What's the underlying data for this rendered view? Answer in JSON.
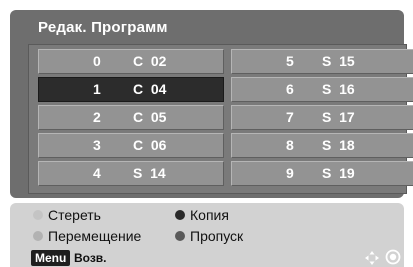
{
  "window": {
    "title": "Редак. Программ"
  },
  "channels": {
    "left": [
      {
        "num": "0",
        "channel": "C  02",
        "selected": false
      },
      {
        "num": "1",
        "channel": "C  04",
        "selected": true
      },
      {
        "num": "2",
        "channel": "C  05",
        "selected": false
      },
      {
        "num": "3",
        "channel": "C  06",
        "selected": false
      },
      {
        "num": "4",
        "channel": "S  14",
        "selected": false
      }
    ],
    "right": [
      {
        "num": "5",
        "channel": "S  15",
        "selected": false
      },
      {
        "num": "6",
        "channel": "S  16",
        "selected": false
      },
      {
        "num": "7",
        "channel": "S  17",
        "selected": false
      },
      {
        "num": "8",
        "channel": "S  18",
        "selected": false
      },
      {
        "num": "9",
        "channel": "S  19",
        "selected": false
      }
    ]
  },
  "legend": {
    "delete_label": "Стереть",
    "delete_color": "#c4c4c4",
    "copy_label": "Копия",
    "copy_color": "#2a2a2a",
    "move_label": "Перемещение",
    "move_color": "#b2b2b2",
    "skip_label": "Пропуск",
    "skip_color": "#5a5a5a"
  },
  "footer": {
    "menu_key": "Menu",
    "back_label": "Возв.",
    "nav_icon": "dpad-arrows-icon",
    "ok_icon": "ok-button-icon"
  }
}
